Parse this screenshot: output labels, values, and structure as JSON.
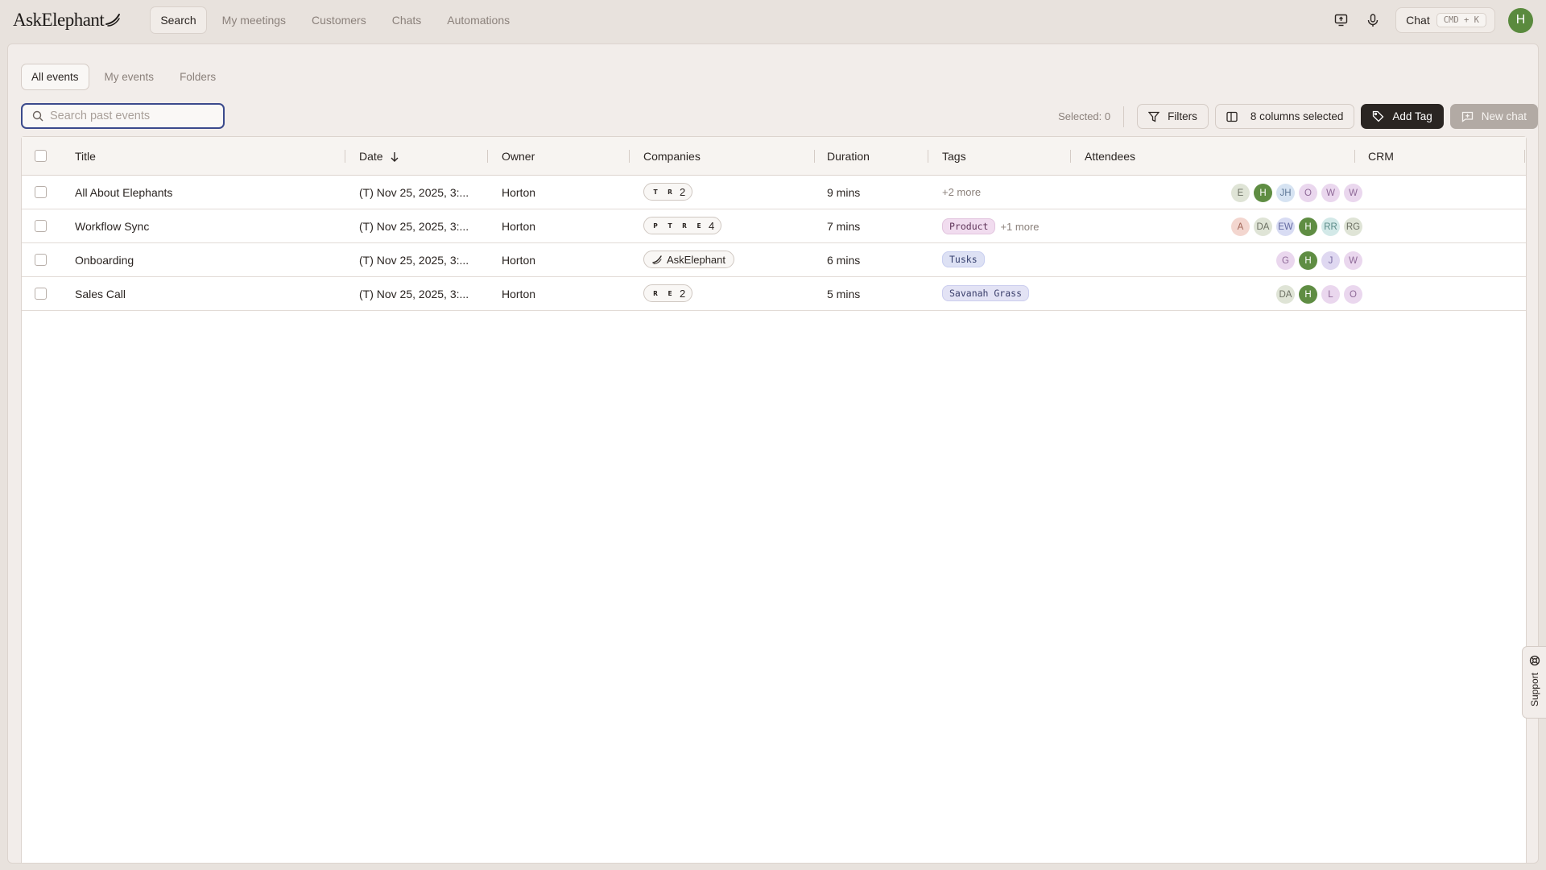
{
  "app": {
    "logo_text": "AskElephant"
  },
  "nav": {
    "items": [
      {
        "label": "Search",
        "active": true
      },
      {
        "label": "My meetings",
        "active": false
      },
      {
        "label": "Customers",
        "active": false
      },
      {
        "label": "Chats",
        "active": false
      },
      {
        "label": "Automations",
        "active": false
      }
    ],
    "chat_label": "Chat",
    "chat_shortcut": "CMD + K",
    "user_initial": "H",
    "icons": [
      "screen-share-icon",
      "microphone-icon"
    ]
  },
  "subtabs": [
    {
      "label": "All events",
      "active": true
    },
    {
      "label": "My events",
      "active": false
    },
    {
      "label": "Folders",
      "active": false
    }
  ],
  "search": {
    "placeholder": "Search past events",
    "value": ""
  },
  "toolbar": {
    "selected_label": "Selected: 0",
    "filters_label": "Filters",
    "columns_label": "8 columns selected",
    "add_tag_label": "Add Tag",
    "new_chat_label": "New chat"
  },
  "table": {
    "columns": [
      "Title",
      "Date",
      "Owner",
      "Companies",
      "Duration",
      "Tags",
      "Attendees",
      "CRM"
    ],
    "sort_indicator": "descending-arrow-icon",
    "rows": [
      {
        "title": "All About Elephants",
        "date": "(T) Nov 25, 2025, 3:...",
        "owner": "Horton",
        "companies": {
          "letters": [
            "T",
            "R"
          ],
          "count": "2"
        },
        "duration": "9 mins",
        "tags": [],
        "more": "+2 more",
        "attendees": [
          {
            "i": "E",
            "c": "grey"
          },
          {
            "i": "H",
            "c": "green"
          },
          {
            "i": "JH",
            "c": "blue"
          },
          {
            "i": "O",
            "c": "purple"
          },
          {
            "i": "W",
            "c": "purple"
          },
          {
            "i": "W",
            "c": "purple"
          }
        ]
      },
      {
        "title": "Workflow Sync",
        "date": "(T) Nov 25, 2025, 3:...",
        "owner": "Horton",
        "companies": {
          "letters": [
            "P",
            "T",
            "R",
            "E"
          ],
          "count": "4"
        },
        "duration": "7 mins",
        "tags": [
          {
            "label": "Product",
            "style": "product"
          }
        ],
        "more": "+1 more",
        "attendees": [
          {
            "i": "A",
            "c": "salmon"
          },
          {
            "i": "DA",
            "c": "grey"
          },
          {
            "i": "EW",
            "c": "indigo"
          },
          {
            "i": "H",
            "c": "green"
          },
          {
            "i": "RR",
            "c": "teal"
          },
          {
            "i": "RG",
            "c": "grey"
          }
        ]
      },
      {
        "title": "Onboarding",
        "date": "(T) Nov 25, 2025, 3:...",
        "owner": "Horton",
        "companies": {
          "name": "AskElephant"
        },
        "duration": "6 mins",
        "tags": [
          {
            "label": "Tusks",
            "style": "tusks"
          }
        ],
        "more": "",
        "attendees": [
          {
            "i": "G",
            "c": "purple"
          },
          {
            "i": "H",
            "c": "green"
          },
          {
            "i": "J",
            "c": "lilac"
          },
          {
            "i": "W",
            "c": "purple"
          }
        ]
      },
      {
        "title": "Sales Call",
        "date": "(T) Nov 25, 2025, 3:...",
        "owner": "Horton",
        "companies": {
          "letters": [
            "R",
            "E"
          ],
          "count": "2"
        },
        "duration": "5 mins",
        "tags": [
          {
            "label": "Savanah Grass",
            "style": "grass"
          }
        ],
        "more": "",
        "attendees": [
          {
            "i": "DA",
            "c": "grey"
          },
          {
            "i": "H",
            "c": "green"
          },
          {
            "i": "L",
            "c": "purple"
          },
          {
            "i": "O",
            "c": "purple"
          }
        ]
      }
    ]
  },
  "support_label": "Support",
  "colors": {
    "accent_dark": "#2a2522",
    "focus_border": "#3b4a8c",
    "avatar_green": "#5a8a3e"
  }
}
